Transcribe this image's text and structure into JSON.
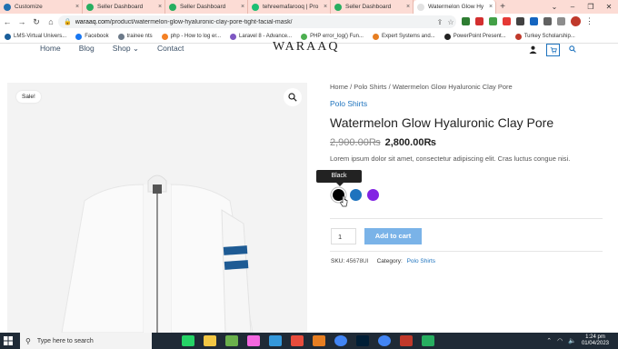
{
  "browser": {
    "tabs": [
      {
        "title": "Customize",
        "color": "#2271b1",
        "active": false
      },
      {
        "title": "Seller Dashboard",
        "color": "#27ae60",
        "active": false
      },
      {
        "title": "Seller Dashboard",
        "color": "#27ae60",
        "active": false
      },
      {
        "title": "tehreemafarooq | Pro",
        "color": "#1dbf73",
        "active": false
      },
      {
        "title": "Seller Dashboard",
        "color": "#27ae60",
        "active": false
      },
      {
        "title": "Watermelon Glow Hy",
        "color": "#e2e2e2",
        "active": true
      }
    ],
    "url_host": "waraaq.com",
    "url_path": "/product/watermelon-glow-hyaluronic-clay-pore-tight-facial-mask/",
    "bookmarks": [
      {
        "label": "LMS-Virtual Univers...",
        "color": "#1a5e9a"
      },
      {
        "label": "Facebook",
        "color": "#1877f2"
      },
      {
        "label": "trainee nts",
        "color": "#6c7a89"
      },
      {
        "label": "php - How to log er...",
        "color": "#f48024"
      },
      {
        "label": "Laravel 8 - Advance...",
        "color": "#7e57c2"
      },
      {
        "label": "PHP error_log() Fun...",
        "color": "#4caf50"
      },
      {
        "label": "Expert Systems and...",
        "color": "#e67e22"
      },
      {
        "label": "PowerPoint Present...",
        "color": "#222222"
      },
      {
        "label": "Turkey Scholarship...",
        "color": "#c0392b"
      }
    ]
  },
  "site": {
    "nav": [
      "Home",
      "Blog",
      "Shop ⌄",
      "Contact"
    ],
    "logo": "WARAAQ"
  },
  "product": {
    "sale_badge": "Sale!",
    "breadcrumb": {
      "home": "Home",
      "sep1": " / ",
      "cat": "Polo Shirts",
      "sep2": " / ",
      "current": "Watermelon Glow Hyaluronic Clay Pore"
    },
    "category_link": "Polo Shirts",
    "title": "Watermelon Glow Hyaluronic Clay Pore",
    "old_price": "2,900.00₨",
    "new_price": "2,800.00₨",
    "description": "Lorem ipsum dolor sit amet, consectetur adipiscing elit. Cras luctus congue nisi.",
    "tooltip": "Black",
    "swatches": [
      {
        "name": "Black",
        "color": "#000000"
      },
      {
        "name": "Blue",
        "color": "#1e73be"
      },
      {
        "name": "Purple",
        "color": "#8224e3"
      }
    ],
    "quantity": "1",
    "add_to_cart": "Add to cart",
    "sku_label": "SKU:",
    "sku": "45678UI",
    "category_label": "Category:",
    "category": "Polo Shirts"
  },
  "taskbar": {
    "search_placeholder": "Type here to search",
    "time": "1:24 pm",
    "date": "01/04/2023"
  }
}
